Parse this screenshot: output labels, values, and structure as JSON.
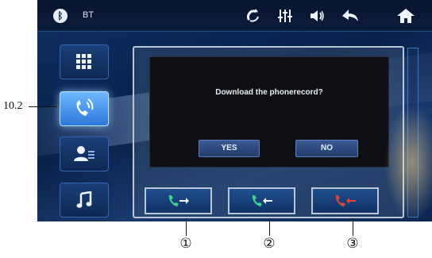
{
  "status_bar": {
    "bluetooth_icon": "bluetooth-icon",
    "label": "BT",
    "icons": [
      "phone-sync-icon",
      "equalizer-icon",
      "volume-icon",
      "back-icon",
      "home-icon"
    ]
  },
  "sidebar": {
    "items": [
      {
        "icon": "keypad-icon"
      },
      {
        "icon": "call-icon",
        "active": true
      },
      {
        "icon": "contacts-icon"
      },
      {
        "icon": "music-icon"
      }
    ]
  },
  "dialog": {
    "message": "Download the phonerecord?",
    "yes_label": "YES",
    "no_label": "NO"
  },
  "call_buttons": [
    {
      "icon": "outgoing-call-icon"
    },
    {
      "icon": "incoming-call-icon"
    },
    {
      "icon": "missed-call-icon"
    }
  ],
  "annotations": {
    "callout": "10.2",
    "numbers": [
      "①",
      "②",
      "③"
    ]
  },
  "colors": {
    "missed_red": "#e2433b",
    "call_green": "#3fd08a",
    "active_blue": "#6fb8ff"
  }
}
